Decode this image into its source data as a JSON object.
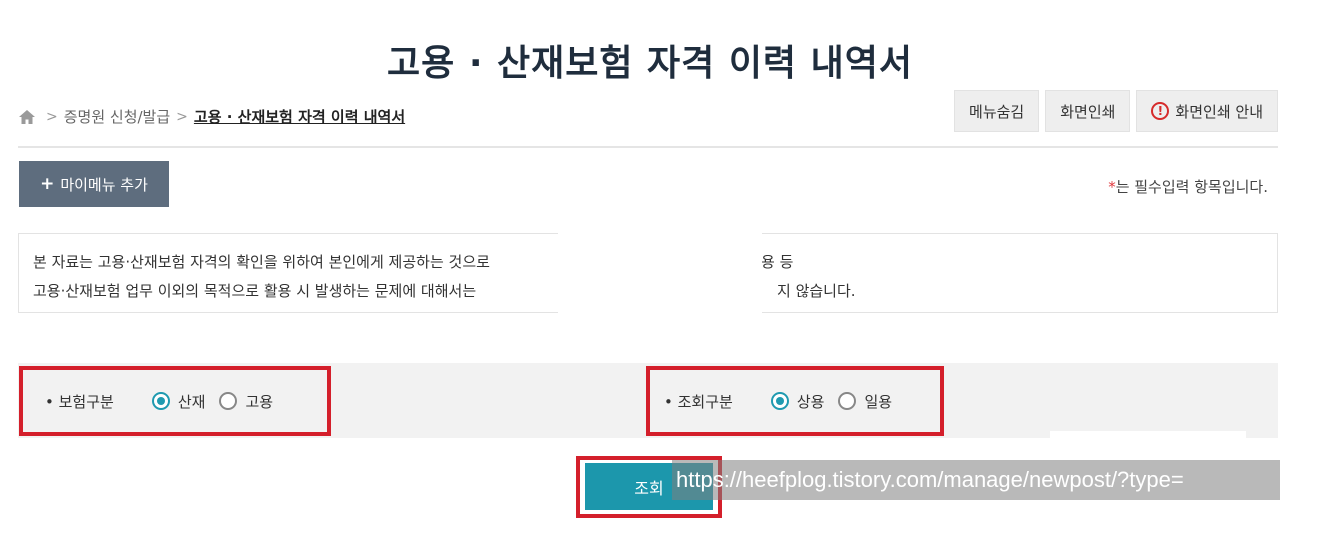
{
  "page": {
    "title": "고용 · 산재보험 자격 이력 내역서"
  },
  "breadcrumb": {
    "icon": "home-icon",
    "items": [
      "증명원 신청/발급",
      "고용 · 산재보험 자격 이력 내역서"
    ],
    "separator": ">"
  },
  "top_buttons": {
    "hide_menu": "메뉴숨김",
    "print": "화면인쇄",
    "print_guide": "화면인쇄 안내"
  },
  "mymenu": {
    "plus": "+",
    "label": "마이메뉴 추가"
  },
  "required_note": {
    "star": "*",
    "text": "는 필수입력 항목입니다."
  },
  "notice": {
    "line1_left": "본 자료는 고용·산재보험 자격의 확인을 위하여 본인에게 제공하는 것으로",
    "line1_right": "용 등",
    "line2_left": "고용·산재보험 업무 이외의 목적으로 활용 시 발생하는 문제에 대해서는 ",
    "line2_right": "지 않습니다."
  },
  "filters": {
    "insurance": {
      "label": "• 보험구분",
      "options": [
        "산재",
        "고용"
      ],
      "selected": "산재"
    },
    "query": {
      "label": "• 조회구분",
      "options": [
        "상용",
        "일용"
      ],
      "selected": "상용"
    }
  },
  "search_button": "조회",
  "watermark_url": "https://heefplog.tistory.com/manage/newpost/?type=",
  "colors": {
    "accent": "#1c97ac",
    "highlight": "#d41f2b",
    "menu_button": "#5e6d7e"
  }
}
